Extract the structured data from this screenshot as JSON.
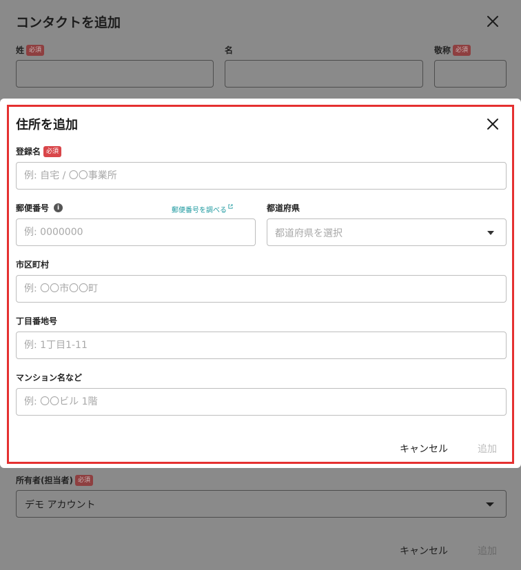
{
  "background_dialog": {
    "title": "コンタクトを追加",
    "fields": {
      "last_name_label": "姓",
      "first_name_label": "名",
      "honorific_label": "敬称",
      "owner_label": "所有者(担当者)",
      "owner_value": "デモ アカウント"
    },
    "required_badge": "必須",
    "cancel_label": "キャンセル",
    "add_label": "追加"
  },
  "address_dialog": {
    "title": "住所を追加",
    "required_badge": "必須",
    "registration_name": {
      "label": "登録名",
      "placeholder": "例: 自宅 / 〇〇事業所"
    },
    "postal_code": {
      "label": "郵便番号",
      "placeholder": "例: 0000000",
      "lookup_link": "郵便番号を調べる"
    },
    "prefecture": {
      "label": "都道府県",
      "placeholder": "都道府県を選択"
    },
    "city": {
      "label": "市区町村",
      "placeholder": "例: 〇〇市〇〇町"
    },
    "street": {
      "label": "丁目番地号",
      "placeholder": "例: 1丁目1-11"
    },
    "building": {
      "label": "マンション名など",
      "placeholder": "例: 〇〇ビル 1階"
    },
    "cancel_label": "キャンセル",
    "add_label": "追加"
  },
  "colors": {
    "accent_link": "#1f9aa0",
    "required_badge": "#d9464a",
    "highlight_border": "#e53030"
  }
}
